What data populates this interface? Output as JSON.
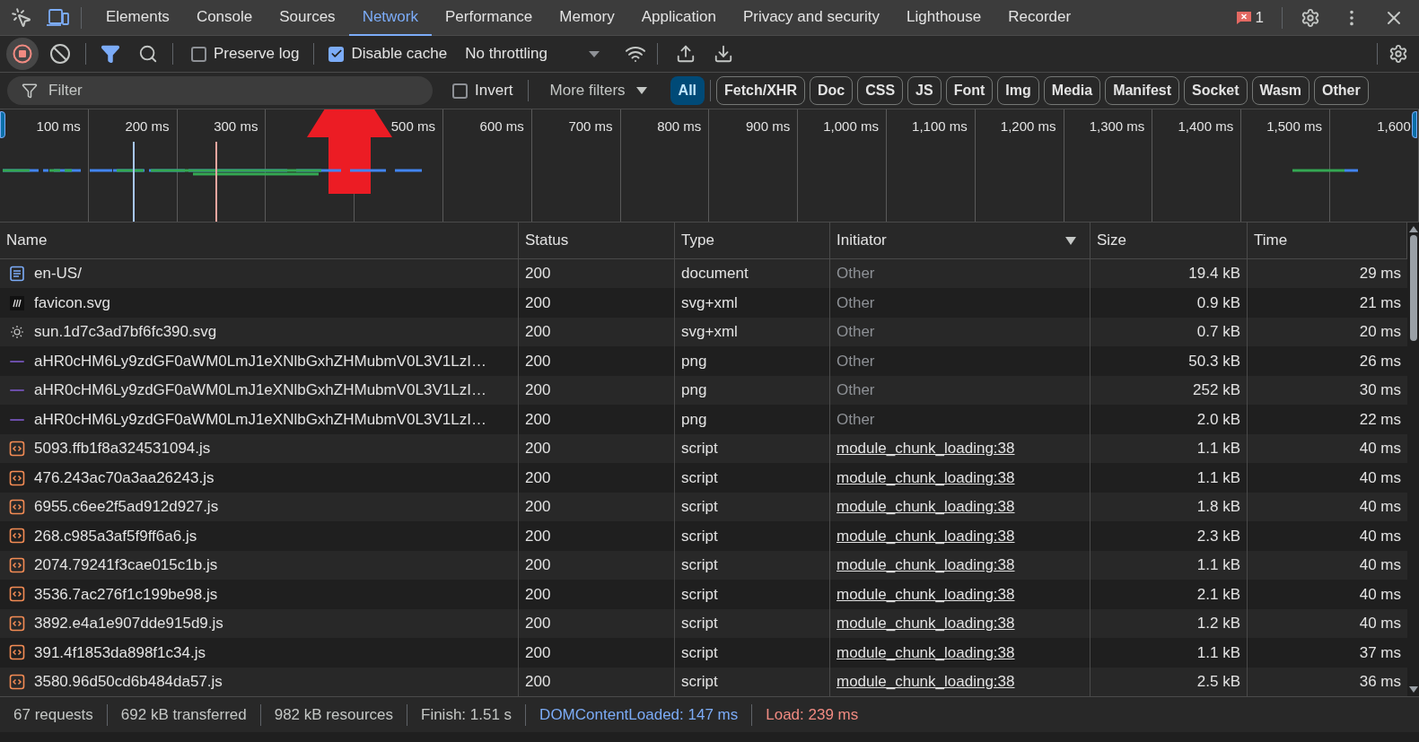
{
  "tabs": [
    {
      "label": "Elements",
      "selected": false
    },
    {
      "label": "Console",
      "selected": false
    },
    {
      "label": "Sources",
      "selected": false
    },
    {
      "label": "Network",
      "selected": true
    },
    {
      "label": "Performance",
      "selected": false
    },
    {
      "label": "Memory",
      "selected": false
    },
    {
      "label": "Application",
      "selected": false
    },
    {
      "label": "Privacy and security",
      "selected": false
    },
    {
      "label": "Lighthouse",
      "selected": false
    },
    {
      "label": "Recorder",
      "selected": false
    }
  ],
  "error_count": "1",
  "toolbar": {
    "recording": true,
    "filter_on": true,
    "preserve_log": {
      "label": "Preserve log",
      "checked": false
    },
    "disable_cache": {
      "label": "Disable cache",
      "checked": true
    },
    "throttling": "No throttling"
  },
  "filter_bar": {
    "placeholder": "Filter",
    "invert": {
      "label": "Invert",
      "checked": false
    },
    "more_filters": "More filters",
    "types": [
      {
        "label": "All",
        "selected": true
      },
      {
        "label": "Fetch/XHR",
        "selected": false
      },
      {
        "label": "Doc",
        "selected": false
      },
      {
        "label": "CSS",
        "selected": false
      },
      {
        "label": "JS",
        "selected": false
      },
      {
        "label": "Font",
        "selected": false
      },
      {
        "label": "Img",
        "selected": false
      },
      {
        "label": "Media",
        "selected": false
      },
      {
        "label": "Manifest",
        "selected": false
      },
      {
        "label": "Socket",
        "selected": false
      },
      {
        "label": "Wasm",
        "selected": false
      },
      {
        "label": "Other",
        "selected": false
      }
    ]
  },
  "timeline": {
    "ticks": [
      {
        "label": "100 ms"
      },
      {
        "label": "200 ms"
      },
      {
        "label": "300 ms"
      },
      {
        "arrow_annotation": true
      },
      {
        "label": "500 ms"
      },
      {
        "label": "600 ms"
      },
      {
        "label": "700 ms"
      },
      {
        "label": "800 ms"
      },
      {
        "label": "900 ms"
      },
      {
        "label": "1,000 ms"
      },
      {
        "label": "1,100 ms"
      },
      {
        "label": "1,200 ms"
      },
      {
        "label": "1,300 ms"
      },
      {
        "label": "1,400 ms"
      },
      {
        "label": "1,500 ms"
      },
      {
        "label": "1,600"
      }
    ]
  },
  "table": {
    "columns": [
      "Name",
      "Status",
      "Type",
      "Initiator",
      "Size",
      "Time"
    ],
    "rows": [
      {
        "kind": "document",
        "name": "en-US/",
        "status": "200",
        "type": "document",
        "initiator": "Other",
        "initiator_link": false,
        "size": "19.4 kB",
        "time": "29 ms"
      },
      {
        "kind": "logo",
        "name": "favicon.svg",
        "status": "200",
        "type": "svg+xml",
        "initiator": "Other",
        "initiator_link": false,
        "size": "0.9 kB",
        "time": "21 ms"
      },
      {
        "kind": "sun",
        "name": "sun.1d7c3ad7bf6fc390.svg",
        "status": "200",
        "type": "svg+xml",
        "initiator": "Other",
        "initiator_link": false,
        "size": "0.7 kB",
        "time": "20 ms"
      },
      {
        "kind": "image",
        "name": "aHR0cHM6Ly9zdGF0aWM0LmJ1eXNlbGxhZHMubmV0L3V1LzI…",
        "status": "200",
        "type": "png",
        "initiator": "Other",
        "initiator_link": false,
        "size": "50.3 kB",
        "time": "26 ms"
      },
      {
        "kind": "image",
        "name": "aHR0cHM6Ly9zdGF0aWM0LmJ1eXNlbGxhZHMubmV0L3V1LzI…",
        "status": "200",
        "type": "png",
        "initiator": "Other",
        "initiator_link": false,
        "size": "252 kB",
        "time": "30 ms"
      },
      {
        "kind": "image",
        "name": "aHR0cHM6Ly9zdGF0aWM0LmJ1eXNlbGxhZHMubmV0L3V1LzI…",
        "status": "200",
        "type": "png",
        "initiator": "Other",
        "initiator_link": false,
        "size": "2.0 kB",
        "time": "22 ms"
      },
      {
        "kind": "script",
        "name": "5093.ffb1f8a324531094.js",
        "status": "200",
        "type": "script",
        "initiator": "module_chunk_loading:38",
        "initiator_link": true,
        "size": "1.1 kB",
        "time": "40 ms"
      },
      {
        "kind": "script",
        "name": "476.243ac70a3aa26243.js",
        "status": "200",
        "type": "script",
        "initiator": "module_chunk_loading:38",
        "initiator_link": true,
        "size": "1.1 kB",
        "time": "40 ms"
      },
      {
        "kind": "script",
        "name": "6955.c6ee2f5ad912d927.js",
        "status": "200",
        "type": "script",
        "initiator": "module_chunk_loading:38",
        "initiator_link": true,
        "size": "1.8 kB",
        "time": "40 ms"
      },
      {
        "kind": "script",
        "name": "268.c985a3af5f9ff6a6.js",
        "status": "200",
        "type": "script",
        "initiator": "module_chunk_loading:38",
        "initiator_link": true,
        "size": "2.3 kB",
        "time": "40 ms"
      },
      {
        "kind": "script",
        "name": "2074.79241f3cae015c1b.js",
        "status": "200",
        "type": "script",
        "initiator": "module_chunk_loading:38",
        "initiator_link": true,
        "size": "1.1 kB",
        "time": "40 ms"
      },
      {
        "kind": "script",
        "name": "3536.7ac276f1c199be98.js",
        "status": "200",
        "type": "script",
        "initiator": "module_chunk_loading:38",
        "initiator_link": true,
        "size": "2.1 kB",
        "time": "40 ms"
      },
      {
        "kind": "script",
        "name": "3892.e4a1e907dde915d9.js",
        "status": "200",
        "type": "script",
        "initiator": "module_chunk_loading:38",
        "initiator_link": true,
        "size": "1.2 kB",
        "time": "40 ms"
      },
      {
        "kind": "script",
        "name": "391.4f1853da898f1c34.js",
        "status": "200",
        "type": "script",
        "initiator": "module_chunk_loading:38",
        "initiator_link": true,
        "size": "1.1 kB",
        "time": "37 ms"
      },
      {
        "kind": "script",
        "name": "3580.96d50cd6b484da57.js",
        "status": "200",
        "type": "script",
        "initiator": "module_chunk_loading:38",
        "initiator_link": true,
        "size": "2.5 kB",
        "time": "36 ms"
      }
    ]
  },
  "status_bar": [
    {
      "text": "67 requests"
    },
    {
      "text": "692 kB transferred"
    },
    {
      "text": "982 kB resources"
    },
    {
      "text": "Finish: 1.51 s"
    },
    {
      "text": "DOMContentLoaded: 147 ms",
      "color": "#7cacf8"
    },
    {
      "text": "Load: 239 ms",
      "color": "#f28b82"
    }
  ]
}
